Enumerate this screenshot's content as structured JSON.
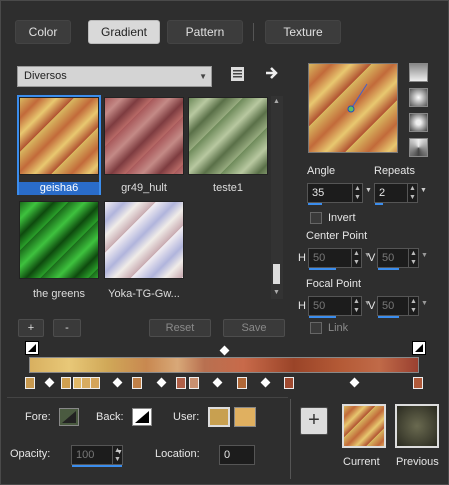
{
  "tabs": [
    "Color",
    "Gradient",
    "Pattern",
    "Texture"
  ],
  "active_tab": "Gradient",
  "category": {
    "selected": "Diversos"
  },
  "gradients": [
    {
      "name": "geisha6",
      "selected": true
    },
    {
      "name": "gr49_hult",
      "selected": false
    },
    {
      "name": "teste1",
      "selected": false
    },
    {
      "name": "the greens",
      "selected": false
    },
    {
      "name": "Yoka-TG-Gw...",
      "selected": false
    }
  ],
  "buttons": {
    "add": "+",
    "remove": "-",
    "reset": "Reset",
    "save": "Save",
    "add_big": "+"
  },
  "angle": {
    "label": "Angle",
    "value": "35"
  },
  "repeats": {
    "label": "Repeats",
    "value": "2"
  },
  "invert": {
    "label": "Invert",
    "checked": false
  },
  "center_point": {
    "label": "Center Point",
    "h_label": "H",
    "h": "50",
    "v_label": "V",
    "v": "50"
  },
  "focal_point": {
    "label": "Focal Point",
    "h_label": "H",
    "h": "50",
    "v_label": "V",
    "v": "50"
  },
  "link": {
    "label": "Link",
    "checked": false
  },
  "fore": {
    "label": "Fore:"
  },
  "back": {
    "label": "Back:"
  },
  "user": {
    "label": "User:",
    "colors": [
      "#c8a050",
      "#e0b060"
    ]
  },
  "opacity": {
    "label": "Opacity:",
    "value": "100"
  },
  "location": {
    "label": "Location:",
    "value": "0"
  },
  "current": {
    "label": "Current"
  },
  "previous": {
    "label": "Previous"
  },
  "colors": {
    "accent": "#3b8ded"
  }
}
